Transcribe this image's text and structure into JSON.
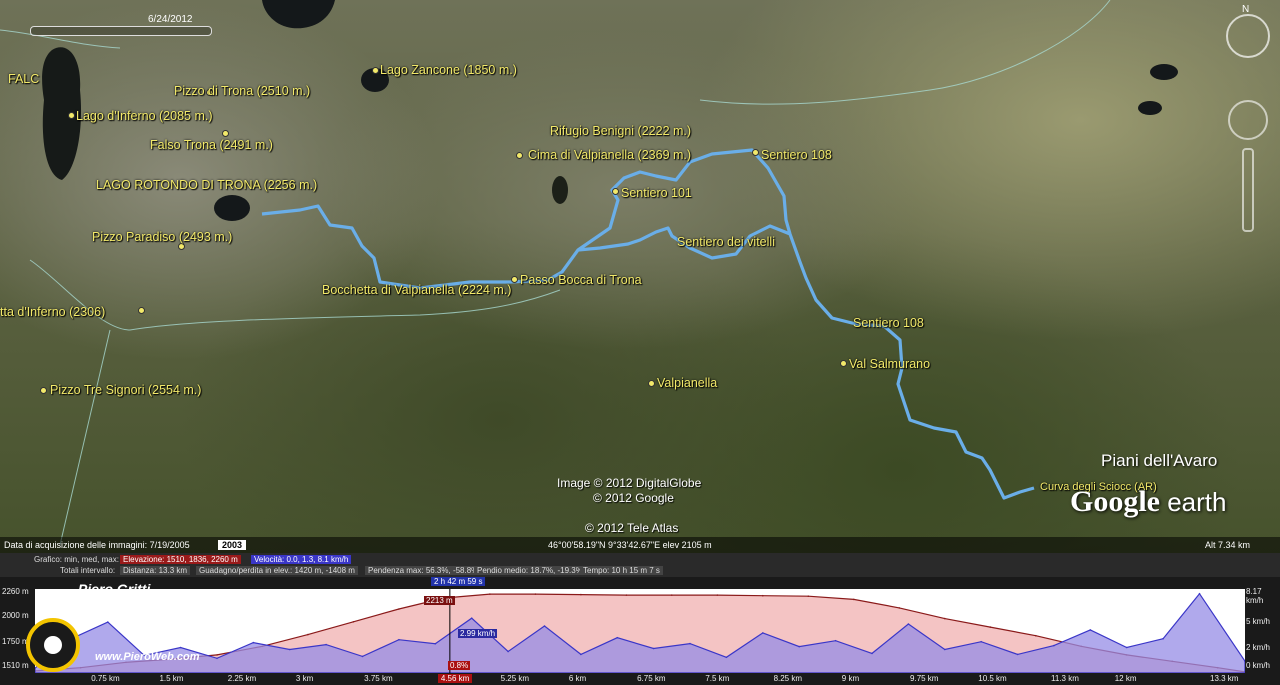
{
  "map": {
    "labels": [
      {
        "text": "FALC"
      },
      {
        "text": "Pizzo di Trona (2510 m.)"
      },
      {
        "text": "Lago Zancone (1850 m.)"
      },
      {
        "text": "Lago d'Inferno (2085 m.)"
      },
      {
        "text": "Falso Trona (2491 m.)"
      },
      {
        "text": "LAGO ROTONDO DI TRONA (2256 m.)"
      },
      {
        "text": "Pizzo Paradiso (2493 m.)"
      },
      {
        "text": "Bocchetta di Valpianella (2224 m.)"
      },
      {
        "text": "Passo Bocca di Trona"
      },
      {
        "text": "tta d'Inferno (2306)"
      },
      {
        "text": "Pizzo Tre Signori (2554 m.)"
      },
      {
        "text": "Rifugio Benigni (2222 m.)"
      },
      {
        "text": "Cima di Valpianella (2369 m.)"
      },
      {
        "text": "Sentiero 101"
      },
      {
        "text": "Sentiero 108"
      },
      {
        "text": "Sentiero dei vitelli"
      },
      {
        "text": "Sentiero 108"
      },
      {
        "text": "Val Salmurano"
      },
      {
        "text": "Valpianella"
      },
      {
        "text": "Curva degli Sciocc (AR)"
      }
    ],
    "place_title": "Piani dell'Avaro",
    "credits": {
      "image": "Image © 2012 DigitalGlobe",
      "google": "© 2012 Google",
      "tele_atlas": "© 2012 Tele Atlas"
    },
    "logo": {
      "word1": "Google",
      "word2": " earth"
    },
    "timeline_date": "6/24/2012",
    "compass_n": "N",
    "track_color": "#6aaee8",
    "label_color": "#f2e96a"
  },
  "statusbar": {
    "acq_label": "Data di acquisizione delle immagini: 7/19/2005",
    "year": "2003",
    "coords": "46°00'58.19\"N   9°33'42.67\"E  elev  2105 m",
    "alt": "Alt   7.34 km"
  },
  "profile": {
    "info_line1_label": "Grafico: min, med, max:",
    "elevation_chip": "Elevazione: 1510, 1836, 2260 m",
    "speed_chip": "Velocità: 0.0, 1.3, 8.1 km/h",
    "info_line2_label": "Totali intervallo:",
    "distance_chip": "Distanza: 13.3 km",
    "gain_chip": "Guadagno/perdita in elev.: 1420 m, -1408 m",
    "slope_chip": "Pendenza max: 56.3%, -58.8%",
    "avg_slope_chip": "Pendio medio: 18.7%, -19.3%",
    "time_chip": "Tempo: 10 h 15 m 7 s",
    "cursor_time": "2 h 42 m 59 s",
    "cursor_elev": "2213 m",
    "cursor_speed": "2.99 km/h",
    "cursor_grade": "0.8%",
    "cursor_km": "4.56 km",
    "author": "Piero Gritti",
    "watermark": "www.PieroWeb.com",
    "y_left": [
      "2260 m",
      "2000 m",
      "1750 m",
      "1510 m"
    ],
    "y_right": [
      "8.17 km/h",
      "5 km/h",
      "2 km/h",
      "0 km/h"
    ],
    "elevation_color": "#8a1a1a",
    "speed_color": "#3a36c8"
  },
  "chart_data": {
    "type": "area",
    "xlabel": "",
    "ylabel": "",
    "x_ticks": [
      "0.75 km",
      "1.5 km",
      "2.25 km",
      "3 km",
      "3.75 km",
      "4.56 km",
      "5.25 km",
      "6 km",
      "6.75 km",
      "7.5 km",
      "8.25 km",
      "9 km",
      "9.75 km",
      "10.5 km",
      "11.3 km",
      "12 km",
      "13.3 km"
    ],
    "xlim": [
      0,
      13.3
    ],
    "series": [
      {
        "name": "Elevazione",
        "unit": "m",
        "ylim": [
          1510,
          2260
        ],
        "x": [
          0,
          0.5,
          1,
          1.5,
          2,
          2.5,
          3,
          3.5,
          4,
          4.5,
          5,
          5.5,
          6,
          6.5,
          7,
          7.5,
          8,
          8.5,
          9,
          9.5,
          10,
          10.5,
          11,
          11.5,
          12,
          12.5,
          13,
          13.3
        ],
        "values": [
          1530,
          1560,
          1610,
          1640,
          1680,
          1760,
          1870,
          1990,
          2110,
          2213,
          2250,
          2250,
          2245,
          2240,
          2240,
          2240,
          2235,
          2230,
          2200,
          2120,
          2020,
          1940,
          1860,
          1760,
          1680,
          1620,
          1560,
          1520
        ]
      },
      {
        "name": "Velocità",
        "unit": "km/h",
        "ylim": [
          0,
          8.17
        ],
        "x": [
          0,
          0.4,
          0.8,
          1.2,
          1.6,
          2,
          2.4,
          2.8,
          3.2,
          3.6,
          4,
          4.4,
          4.8,
          5.2,
          5.6,
          6,
          6.4,
          6.8,
          7.2,
          7.6,
          8,
          8.4,
          8.8,
          9.2,
          9.6,
          10,
          10.4,
          10.8,
          11.2,
          11.6,
          12,
          12.4,
          12.8,
          13.3
        ],
        "values": [
          0.5,
          3.5,
          5.2,
          1.8,
          2.6,
          1.5,
          3.1,
          2.4,
          2.9,
          1.7,
          3.4,
          2.99,
          5.6,
          2.2,
          4.8,
          1.9,
          3.6,
          2.5,
          3.0,
          1.6,
          4.1,
          2.7,
          3.3,
          2.0,
          5.0,
          2.4,
          3.2,
          1.9,
          2.8,
          4.4,
          2.6,
          3.5,
          8.1,
          1.2
        ]
      }
    ]
  }
}
